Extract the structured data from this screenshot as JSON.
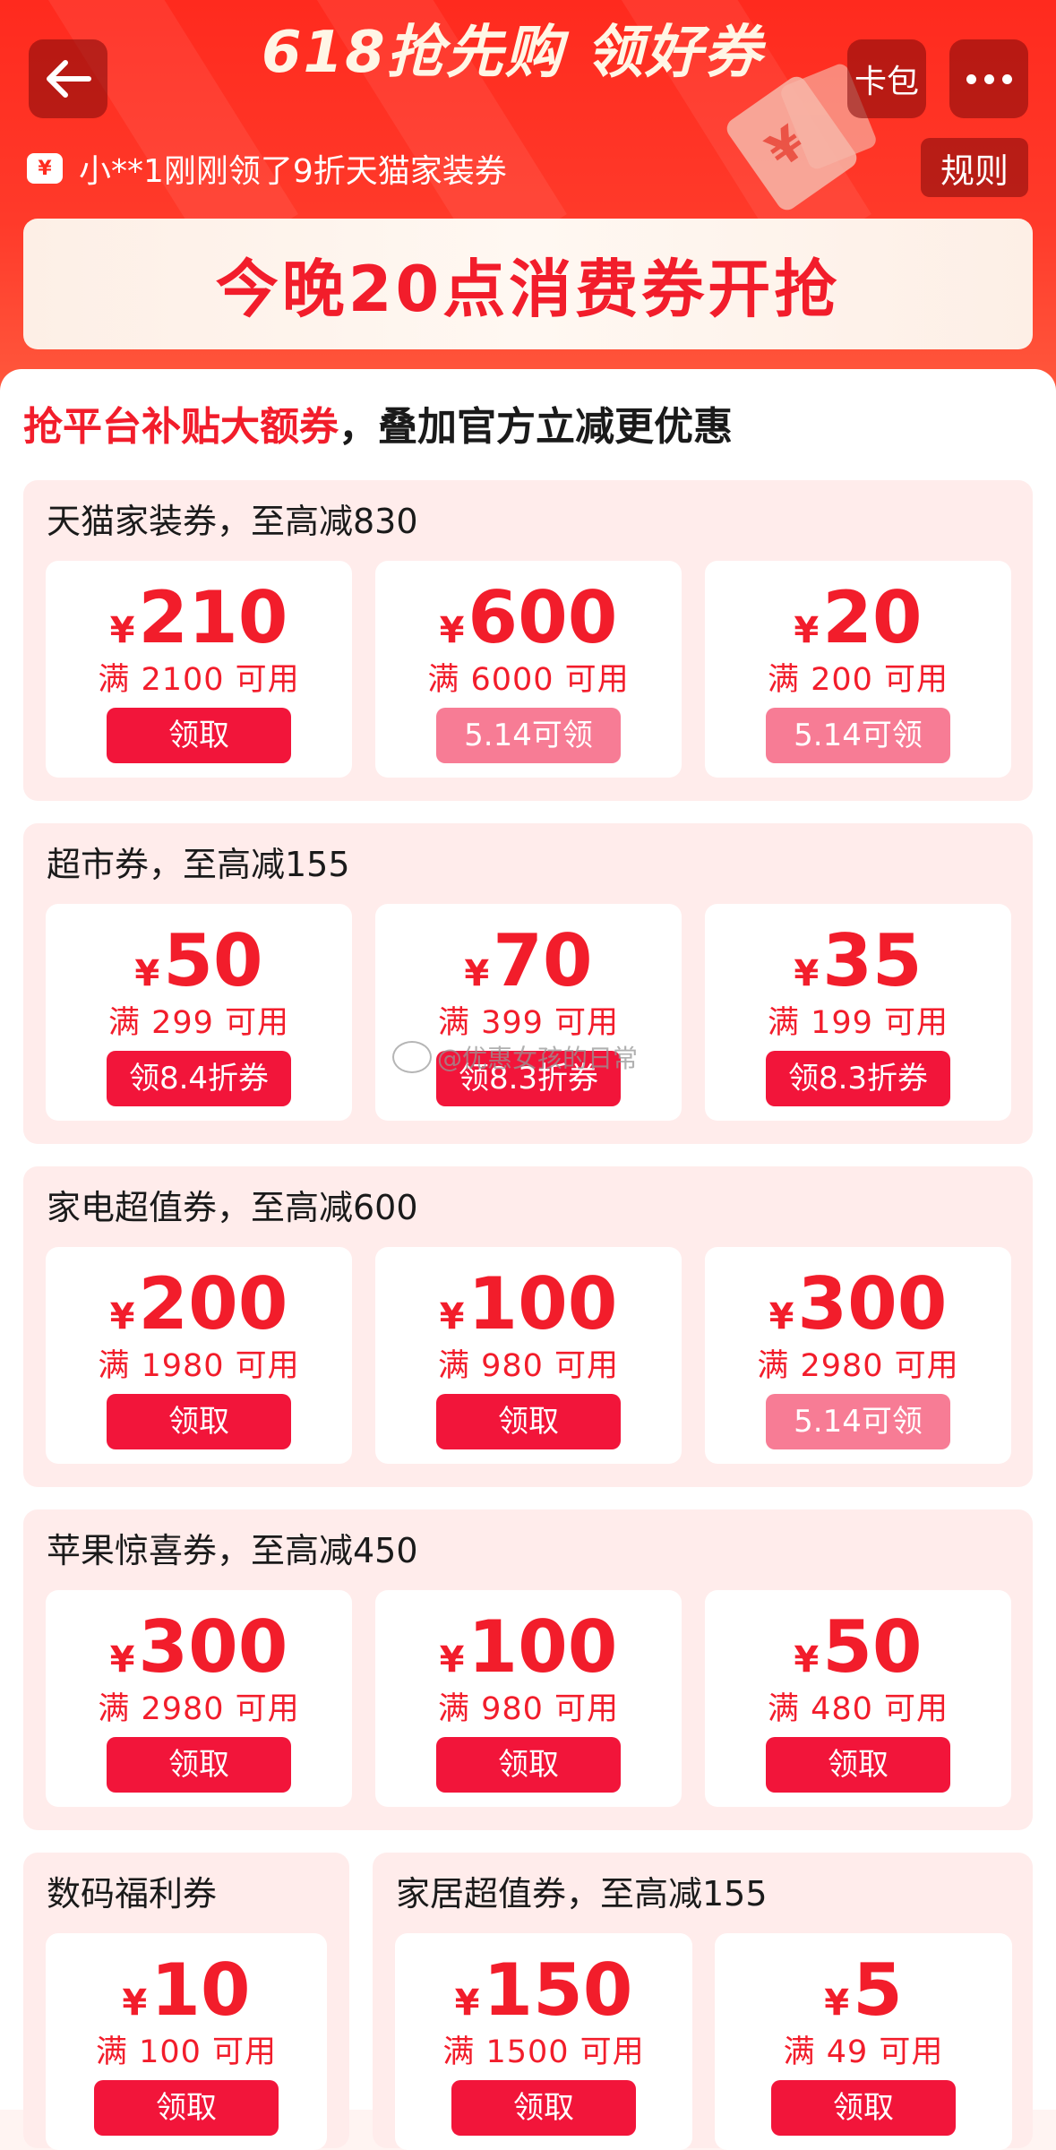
{
  "header": {
    "title": "618抢先购 领好券",
    "kabao": "卡包",
    "notice": "小**1刚刚领了9折天猫家装券",
    "notice_icon": "¥",
    "rules": "规则",
    "banner": "今晚20点消费券开抢"
  },
  "headline": {
    "red": "抢平台补贴大额券",
    "rest": "，叠加官方立减更优惠"
  },
  "sections": [
    {
      "title": "天猫家装券，至高减830",
      "coupons": [
        {
          "amount": "210",
          "condition": "满 2100 可用",
          "button": "领取",
          "state": "active"
        },
        {
          "amount": "600",
          "condition": "满 6000 可用",
          "button": "5.14可领",
          "state": "pending"
        },
        {
          "amount": "20",
          "condition": "满 200 可用",
          "button": "5.14可领",
          "state": "pending"
        }
      ]
    },
    {
      "title": "超市券，至高减155",
      "coupons": [
        {
          "amount": "50",
          "condition": "满 299 可用",
          "button": "领8.4折券",
          "state": "active"
        },
        {
          "amount": "70",
          "condition": "满 399 可用",
          "button": "领8.3折券",
          "state": "active"
        },
        {
          "amount": "35",
          "condition": "满 199 可用",
          "button": "领8.3折券",
          "state": "active"
        }
      ]
    },
    {
      "title": "家电超值券，至高减600",
      "coupons": [
        {
          "amount": "200",
          "condition": "满 1980 可用",
          "button": "领取",
          "state": "active"
        },
        {
          "amount": "100",
          "condition": "满 980 可用",
          "button": "领取",
          "state": "active"
        },
        {
          "amount": "300",
          "condition": "满 2980 可用",
          "button": "5.14可领",
          "state": "pending"
        }
      ]
    },
    {
      "title": "苹果惊喜券，至高减450",
      "coupons": [
        {
          "amount": "300",
          "condition": "满 2980 可用",
          "button": "领取",
          "state": "active"
        },
        {
          "amount": "100",
          "condition": "满 980 可用",
          "button": "领取",
          "state": "active"
        },
        {
          "amount": "50",
          "condition": "满 480 可用",
          "button": "领取",
          "state": "active"
        }
      ]
    },
    {
      "title": "数码福利券",
      "coupons": [
        {
          "amount": "10",
          "condition": "满 100 可用",
          "button": "领取",
          "state": "active"
        }
      ]
    },
    {
      "title": "家居超值券，至高减155",
      "coupons": [
        {
          "amount": "150",
          "condition": "满 1500 可用",
          "button": "领取",
          "state": "active"
        },
        {
          "amount": "5",
          "condition": "满 49 可用",
          "button": "领取",
          "state": "active"
        }
      ]
    }
  ],
  "currency_symbol": "¥",
  "watermark": "@优惠女孩的日常",
  "colors": {
    "header_red": "#FF2A1E",
    "accent_red": "#F21D2B",
    "button_active": "#F2153A",
    "button_pending": "#F77C95",
    "section_bg": "#FFECEB"
  }
}
